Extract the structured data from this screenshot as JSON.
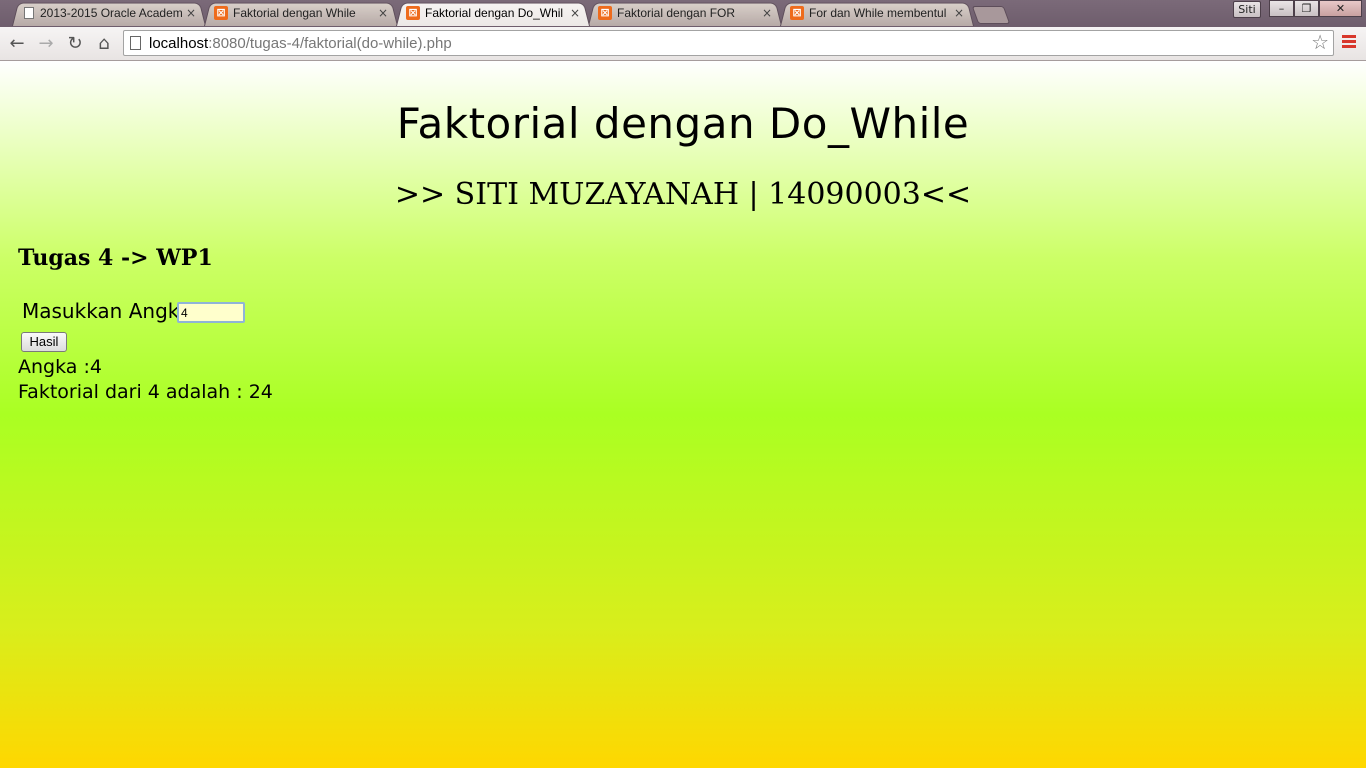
{
  "browser": {
    "tabs": [
      {
        "title": "2013-2015 Oracle Academ",
        "icon": "page-icon",
        "active": false
      },
      {
        "title": "Faktorial dengan While",
        "icon": "xampp-icon",
        "active": false
      },
      {
        "title": "Faktorial dengan Do_Whil",
        "icon": "xampp-icon",
        "active": true
      },
      {
        "title": "Faktorial dengan FOR",
        "icon": "xampp-icon",
        "active": false
      },
      {
        "title": "For dan While membentul",
        "icon": "xampp-icon",
        "active": false
      }
    ],
    "tab_close_glyph": "×",
    "profile_label": "Siti",
    "window_controls": {
      "minimize": "–",
      "restore": "❐",
      "close": "✕"
    },
    "url_host": "localhost",
    "url_rest": ":8080/tugas-4/faktorial(do-while).php",
    "star_glyph": "☆",
    "colors": {
      "accent_xampp": "#ee6b1c",
      "menu_red": "#d8382c"
    }
  },
  "page": {
    "title": "Faktorial dengan Do_While",
    "subtitle": ">> SITI MUZAYANAH | 14090003<<",
    "section": "Tugas 4 -> WP1",
    "form": {
      "label": "Masukkan Angka",
      "input_value": "4",
      "submit_label": "Hasil"
    },
    "result_number": "Angka :4",
    "result_factorial": "Faktorial dari 4 adalah : 24"
  }
}
